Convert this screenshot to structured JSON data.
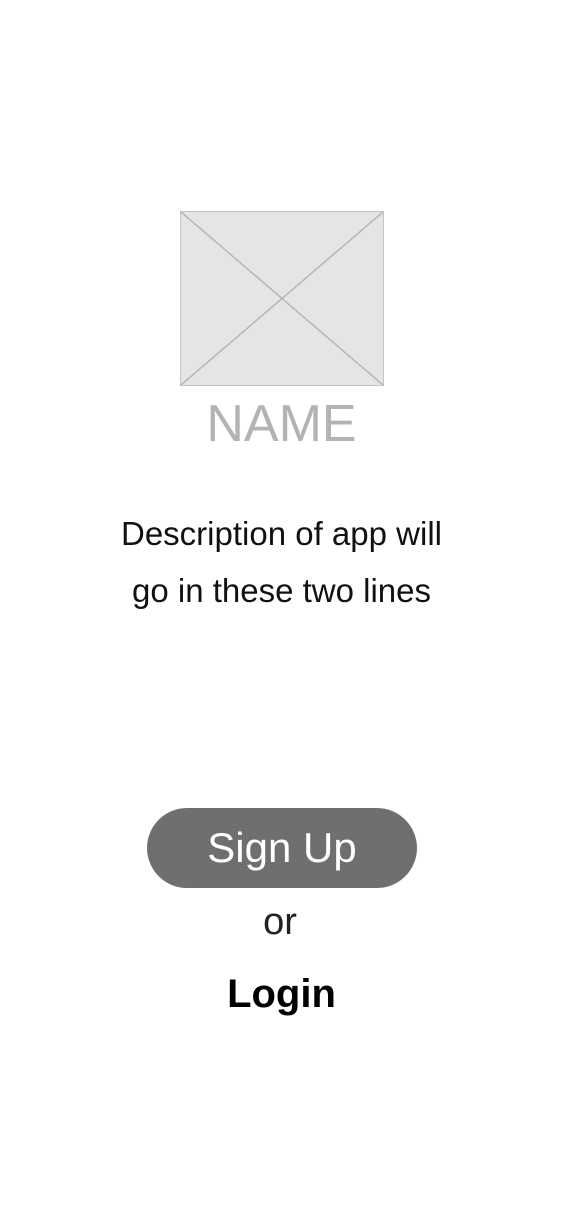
{
  "splash": {
    "logo_icon": "image-placeholder-icon",
    "app_name": "NAME",
    "description_line1": "Description of app will",
    "description_line2": "go in these two lines"
  },
  "actions": {
    "signup_label": "Sign Up",
    "or_label": "or",
    "login_label": "Login"
  },
  "colors": {
    "background": "#ffffff",
    "placeholder_fill": "#e5e5e5",
    "placeholder_stroke": "#b0b0b0",
    "name_text": "#b3b3b3",
    "button_fill": "#6f6f6f",
    "button_text": "#ffffff"
  }
}
